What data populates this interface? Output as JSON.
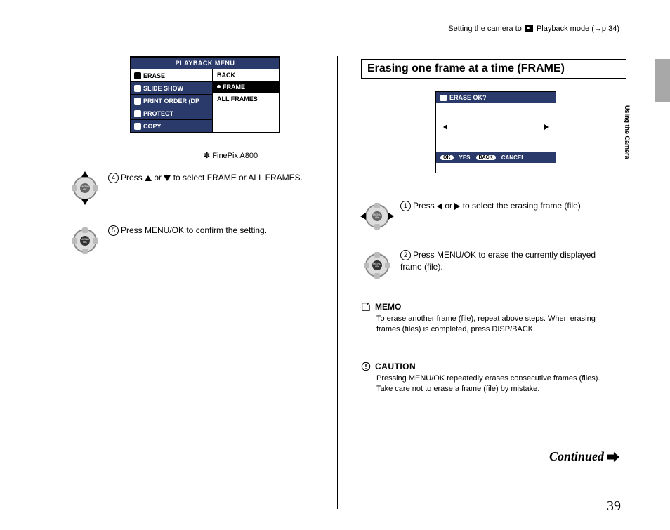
{
  "header": {
    "prefix": "Setting the camera to ",
    "mode": "Playback mode",
    "ref": "(→p.34)"
  },
  "side_label": "Using the Camera",
  "page_number": "39",
  "continued": "Continued",
  "left": {
    "menu_title": "PLAYBACK MENU",
    "menu_items": [
      "ERASE",
      "SLIDE SHOW",
      "PRINT ORDER (DP",
      "PROTECT",
      "COPY"
    ],
    "submenu": [
      "BACK",
      "FRAME",
      "ALL FRAMES"
    ],
    "caption_prefix": "✽ ",
    "caption": "FinePix A800",
    "step4": {
      "num": "4",
      "t1": "Press ",
      "t2": " or ",
      "t3": " to select FRAME or ALL FRAMES."
    },
    "step5": {
      "num": "5",
      "text": "Press MENU/OK to confirm the setting."
    }
  },
  "right": {
    "section_title": "Erasing one frame at a time (FRAME)",
    "lcd": {
      "title": "ERASE OK?",
      "ok": "OK",
      "yes": "YES",
      "back": "BACK",
      "cancel": "CANCEL"
    },
    "step1": {
      "num": "1",
      "t1": "Press ",
      "t2": " or ",
      "t3": " to select the erasing frame (file)."
    },
    "step2": {
      "num": "2",
      "text": "Press MENU/OK to erase the currently displayed frame (file)."
    },
    "memo": {
      "heading": "MEMO",
      "body": "To erase another frame (file), repeat above steps. When erasing frames (files) is completed, press DISP/BACK."
    },
    "caution": {
      "heading": "CAUTION",
      "body": "Pressing MENU/OK repeatedly erases consecutive frames (files). Take care not to erase a frame (file) by mistake."
    }
  }
}
